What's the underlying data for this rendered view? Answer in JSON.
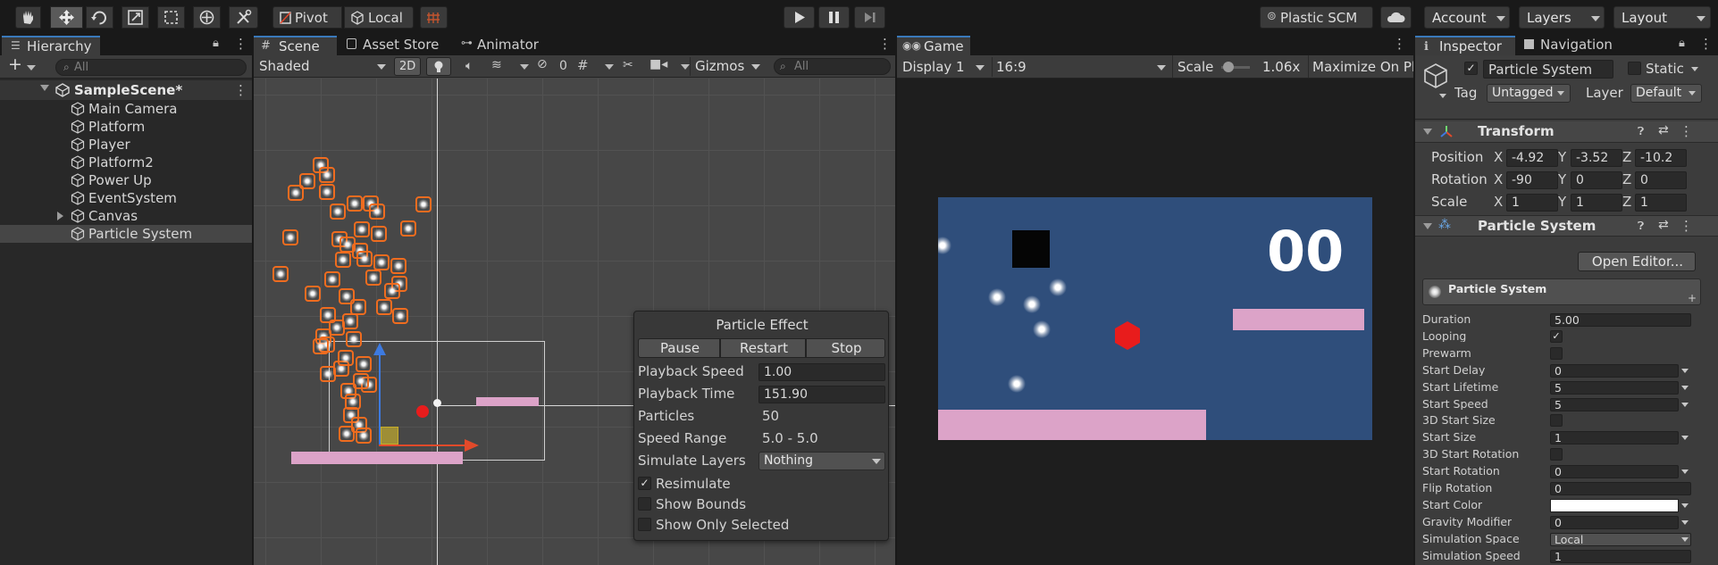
{
  "toolbar": {
    "pivot_label": "Pivot",
    "local_label": "Local",
    "plastic_label": "Plastic SCM",
    "account_label": "Account",
    "layers_label": "Layers",
    "layout_label": "Layout"
  },
  "hierarchy": {
    "tab_label": "Hierarchy",
    "search_placeholder": "All",
    "scene_name": "SampleScene*",
    "items": [
      {
        "label": "Main Camera"
      },
      {
        "label": "Platform"
      },
      {
        "label": "Player"
      },
      {
        "label": "Platform2"
      },
      {
        "label": "Power Up"
      },
      {
        "label": "EventSystem"
      },
      {
        "label": "Canvas"
      },
      {
        "label": "Particle System"
      }
    ]
  },
  "scene": {
    "tabs": [
      "Scene",
      "Asset Store",
      "Animator"
    ],
    "shading_mode": "Shaded",
    "mode_2d": "2D",
    "hidden_count": "0",
    "gizmos_label": "Gizmos",
    "search_placeholder": "All"
  },
  "particle_effect": {
    "title": "Particle Effect",
    "pause_label": "Pause",
    "restart_label": "Restart",
    "stop_label": "Stop",
    "playback_speed_label": "Playback Speed",
    "playback_speed_value": "1.00",
    "playback_time_label": "Playback Time",
    "playback_time_value": "151.90",
    "particles_label": "Particles",
    "particles_value": "50",
    "speed_range_label": "Speed Range",
    "speed_range_value": "5.0 - 5.0",
    "simulate_layers_label": "Simulate Layers",
    "simulate_layers_value": "Nothing",
    "resimulate_label": "Resimulate",
    "resimulate_checked": true,
    "show_bounds_label": "Show Bounds",
    "show_only_selected_label": "Show Only Selected"
  },
  "game": {
    "tab_label": "Game",
    "display_label": "Display 1",
    "aspect_label": "16:9",
    "scale_label": "Scale",
    "scale_value": "1.06x",
    "maximize_label": "Maximize On Pl",
    "score_text": "00"
  },
  "inspector": {
    "tabs": [
      "Inspector",
      "Navigation"
    ],
    "object_name": "Particle System",
    "static_label": "Static",
    "tag_label": "Tag",
    "tag_value": "Untagged",
    "layer_label": "Layer",
    "layer_value": "Default",
    "transform": {
      "title": "Transform",
      "rows": [
        {
          "label": "Position",
          "x": "-4.92",
          "y": "-3.52",
          "z": "-10.2"
        },
        {
          "label": "Rotation",
          "x": "-90",
          "y": "0",
          "z": "0"
        },
        {
          "label": "Scale",
          "x": "1",
          "y": "1",
          "z": "1"
        }
      ],
      "axis_x": "X",
      "axis_y": "Y",
      "axis_z": "Z"
    },
    "particle_system": {
      "title": "Particle System",
      "open_editor_label": "Open Editor...",
      "sub_title": "Particle System",
      "duration_label": "Duration",
      "duration_value": "5.00",
      "looping_label": "Looping",
      "looping_checked": true,
      "prewarm_label": "Prewarm",
      "start_delay_label": "Start Delay",
      "start_delay_value": "0",
      "start_lifetime_label": "Start Lifetime",
      "start_lifetime_value": "5",
      "start_speed_label": "Start Speed",
      "start_speed_value": "5",
      "start_size_3d_label": "3D Start Size",
      "start_size_label": "Start Size",
      "start_size_value": "1",
      "start_rotation_3d_label": "3D Start Rotation",
      "start_rotation_label": "Start Rotation",
      "start_rotation_value": "0",
      "flip_rotation_label": "Flip Rotation",
      "flip_rotation_value": "0",
      "start_color_label": "Start Color",
      "start_color_value": "#ffffff",
      "gravity_label": "Gravity Modifier",
      "gravity_value": "0",
      "sim_space_label": "Simulation Space",
      "sim_space_value": "Local",
      "sim_speed_label": "Simulation Speed",
      "sim_speed_value": "1"
    }
  },
  "colors": {
    "accent_orange": "#ef6c1f",
    "game_background": "#2f4e7b",
    "platform_pink": "#dca3c8",
    "player_red": "#e81c1c"
  }
}
